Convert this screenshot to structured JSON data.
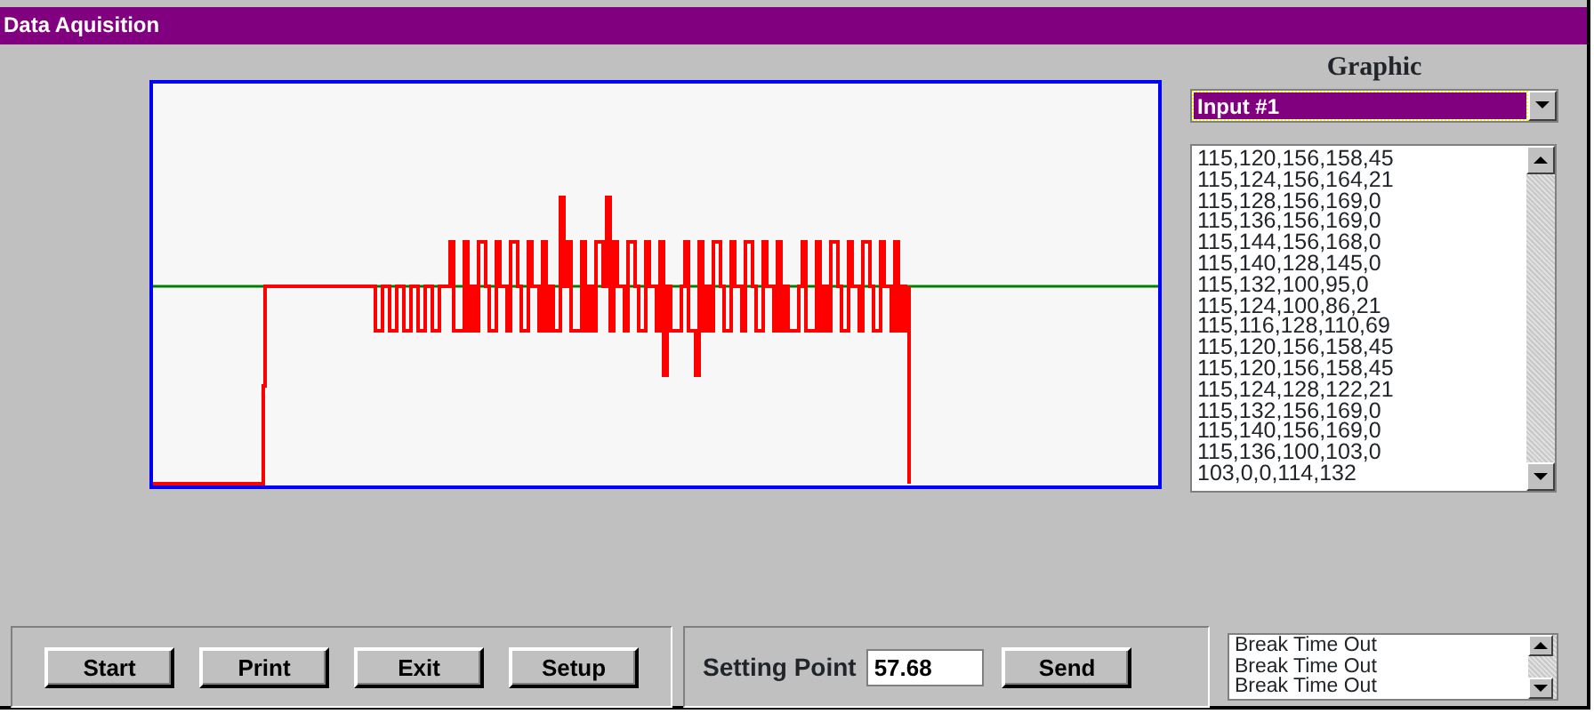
{
  "window": {
    "title": "Data Aquisition"
  },
  "graphic": {
    "label": "Graphic",
    "dropdown": {
      "value": "Input #1"
    }
  },
  "readings": [
    "115,120,156,158,45",
    "115,124,156,164,21",
    "115,128,156,169,0",
    "115,136,156,169,0",
    "115,144,156,168,0",
    "115,140,128,145,0",
    "115,132,100,95,0",
    "115,124,100,86,21",
    "115,116,128,110,69",
    "115,120,156,158,45",
    "115,120,156,158,45",
    "115,124,128,122,21",
    "115,132,156,169,0",
    "115,140,156,169,0",
    "115,136,100,103,0",
    "103,0,0,114,132"
  ],
  "buttons": [
    "Start",
    "Print",
    "Exit",
    "Setup"
  ],
  "setting_point": {
    "label": "Setting Point",
    "value": "57.68",
    "button": "Send"
  },
  "log": [
    "Break Time Out",
    "Break Time Out",
    "Break Time Out"
  ]
}
